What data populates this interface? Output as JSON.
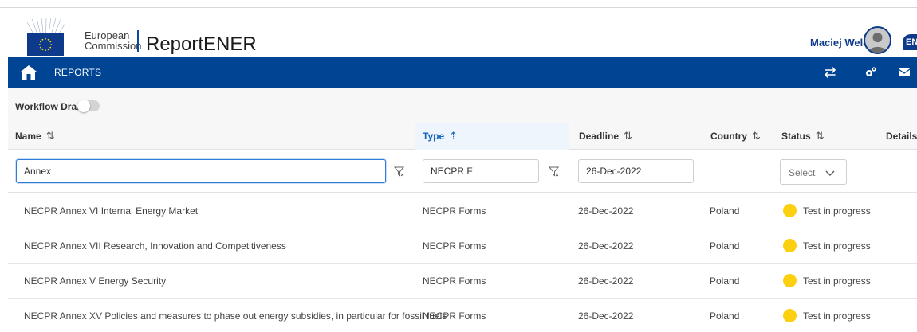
{
  "header": {
    "org_line1": "European",
    "org_line2": "Commission",
    "app_title": "ReportENER",
    "user_name": "Maciej Welc",
    "language": "EN"
  },
  "navbar": {
    "reports_label": "REPORTS",
    "icons": [
      "home-icon",
      "transfer-icon",
      "settings-icon",
      "mail-icon"
    ]
  },
  "toolbar": {
    "workflow_label": "Workflow Draft",
    "workflow_enabled": false
  },
  "table": {
    "columns": [
      {
        "label": "Name",
        "sort": "⇅"
      },
      {
        "label": "Type",
        "sort": "⇡"
      },
      {
        "label": "Deadline",
        "sort": "⇅"
      },
      {
        "label": "Country",
        "sort": "⇅"
      },
      {
        "label": "Status",
        "sort": "⇅"
      },
      {
        "label": "Details"
      }
    ],
    "filters": {
      "name": "Annex",
      "type": "NECPR F",
      "deadline": "26-Dec-2022",
      "status_placeholder": "Select"
    },
    "rows": [
      {
        "name": "NECPR Annex VI Internal Energy Market",
        "type": "NECPR Forms",
        "deadline": "26-Dec-2022",
        "country": "Poland",
        "status": "Test in progress"
      },
      {
        "name": "NECPR Annex VII Research, Innovation and Competitiveness",
        "type": "NECPR Forms",
        "deadline": "26-Dec-2022",
        "country": "Poland",
        "status": "Test in progress"
      },
      {
        "name": "NECPR Annex V Energy Security",
        "type": "NECPR Forms",
        "deadline": "26-Dec-2022",
        "country": "Poland",
        "status": "Test in progress"
      },
      {
        "name": "NECPR Annex XV Policies and measures to phase out energy subsidies, in particular for fossil fuels",
        "type": "NECPR Forms",
        "deadline": "26-Dec-2022",
        "country": "Poland",
        "status": "Test in progress"
      }
    ]
  },
  "colors": {
    "nav_bg": "#004494",
    "brand_blue": "#0e3a8c",
    "status_yellow": "#fccf0f",
    "active_header": "#1565c0"
  }
}
